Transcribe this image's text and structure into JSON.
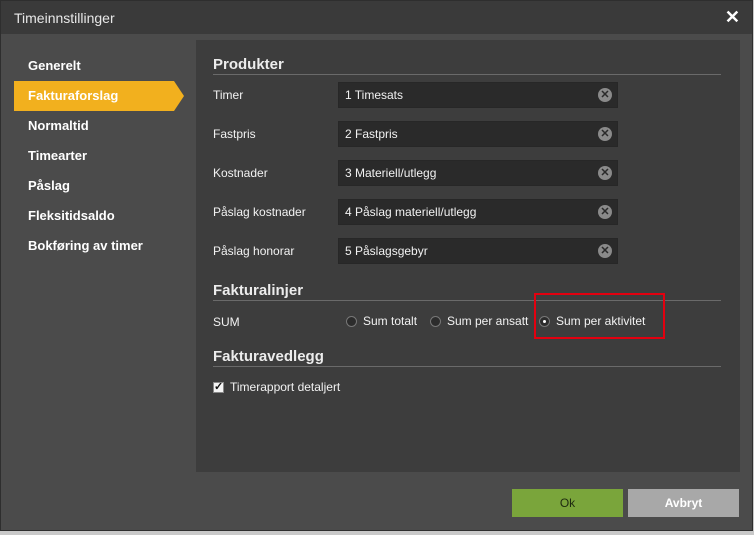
{
  "window": {
    "title": "Timeinnstillinger",
    "close_glyph": "✕"
  },
  "sidebar": {
    "items": [
      {
        "label": "Generelt"
      },
      {
        "label": "Fakturaforslag",
        "active": true
      },
      {
        "label": "Normaltid"
      },
      {
        "label": "Timearter"
      },
      {
        "label": "Påslag"
      },
      {
        "label": "Fleksitidsaldo"
      },
      {
        "label": "Bokføring av timer"
      }
    ]
  },
  "produkter": {
    "heading": "Produkter",
    "rows": [
      {
        "label": "Timer",
        "value": "1 Timesats"
      },
      {
        "label": "Fastpris",
        "value": "2 Fastpris"
      },
      {
        "label": "Kostnader",
        "value": "3 Materiell/utlegg"
      },
      {
        "label": "Påslag kostnader",
        "value": "4 Påslag materiell/utlegg"
      },
      {
        "label": "Påslag honorar",
        "value": "5 Påslagsgebyr"
      }
    ],
    "clear_glyph": "✕"
  },
  "fakturalinjer": {
    "heading": "Fakturalinjer",
    "label": "SUM",
    "options": [
      {
        "label": "Sum totalt",
        "selected": false
      },
      {
        "label": "Sum per ansatt",
        "selected": false
      },
      {
        "label": "Sum per aktivitet",
        "selected": true
      }
    ]
  },
  "fakturavedlegg": {
    "heading": "Fakturavedlegg",
    "checkbox_label": "Timerapport detaljert",
    "checked": true
  },
  "buttons": {
    "ok": "Ok",
    "cancel": "Avbryt"
  },
  "colors": {
    "accent": "#f2b01e",
    "ok_button": "#7aa53b",
    "cancel_button": "#a8a8a8",
    "highlight": "#e3000f"
  }
}
